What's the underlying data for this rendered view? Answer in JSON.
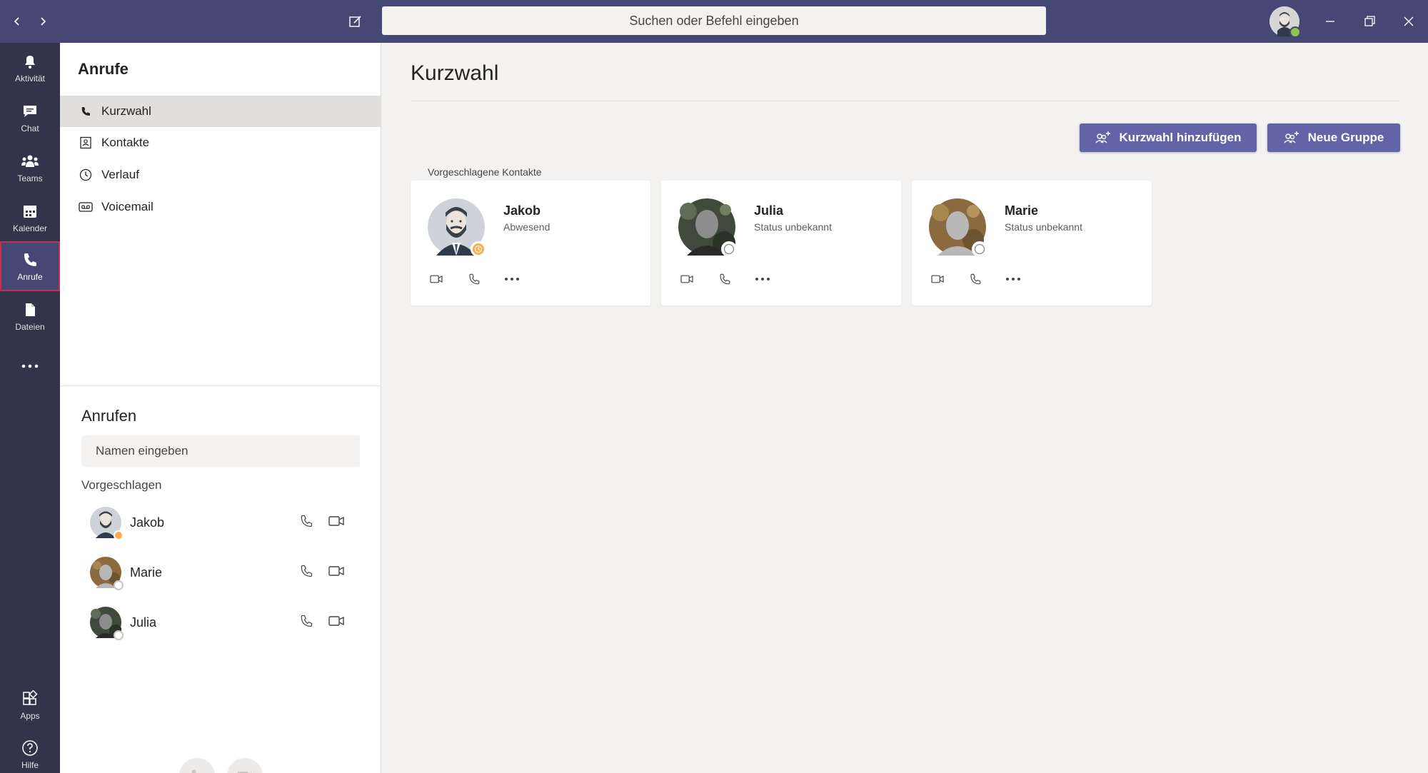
{
  "topbar": {
    "search_placeholder": "Suchen oder Befehl eingeben"
  },
  "rail": {
    "items": [
      {
        "label": "Aktivität",
        "icon": "bell-icon"
      },
      {
        "label": "Chat",
        "icon": "chat-icon"
      },
      {
        "label": "Teams",
        "icon": "teams-icon"
      },
      {
        "label": "Kalender",
        "icon": "calendar-icon"
      },
      {
        "label": "Anrufe",
        "icon": "phone-icon",
        "active": true
      },
      {
        "label": "Dateien",
        "icon": "files-icon"
      }
    ],
    "bottom": [
      {
        "label": "Apps",
        "icon": "apps-icon"
      },
      {
        "label": "Hilfe",
        "icon": "help-icon"
      }
    ]
  },
  "panel": {
    "title": "Anrufe",
    "menu": [
      {
        "label": "Kurzwahl",
        "icon": "phone-icon",
        "selected": true
      },
      {
        "label": "Kontakte",
        "icon": "contacts-icon"
      },
      {
        "label": "Verlauf",
        "icon": "clock-icon"
      },
      {
        "label": "Voicemail",
        "icon": "voicemail-icon"
      }
    ],
    "call_title": "Anrufen",
    "name_placeholder": "Namen eingeben",
    "suggested_label": "Vorgeschlagen",
    "suggested": [
      {
        "name": "Jakob",
        "status": "away"
      },
      {
        "name": "Marie",
        "status": "unknown"
      },
      {
        "name": "Julia",
        "status": "unknown"
      }
    ]
  },
  "main": {
    "title": "Kurzwahl",
    "add_speed_dial": "Kurzwahl hinzufügen",
    "new_group": "Neue Gruppe",
    "suggested_contacts_label": "Vorgeschlagene Kontakte",
    "cards": [
      {
        "name": "Jakob",
        "status": "Abwesend"
      },
      {
        "name": "Julia",
        "status": "Status unbekannt"
      },
      {
        "name": "Marie",
        "status": "Status unbekannt"
      }
    ]
  },
  "colors": {
    "titlebar": "#464775",
    "rail": "#33344a",
    "accent": "#6264a7",
    "away": "#ffaa44",
    "available": "#92c353"
  }
}
